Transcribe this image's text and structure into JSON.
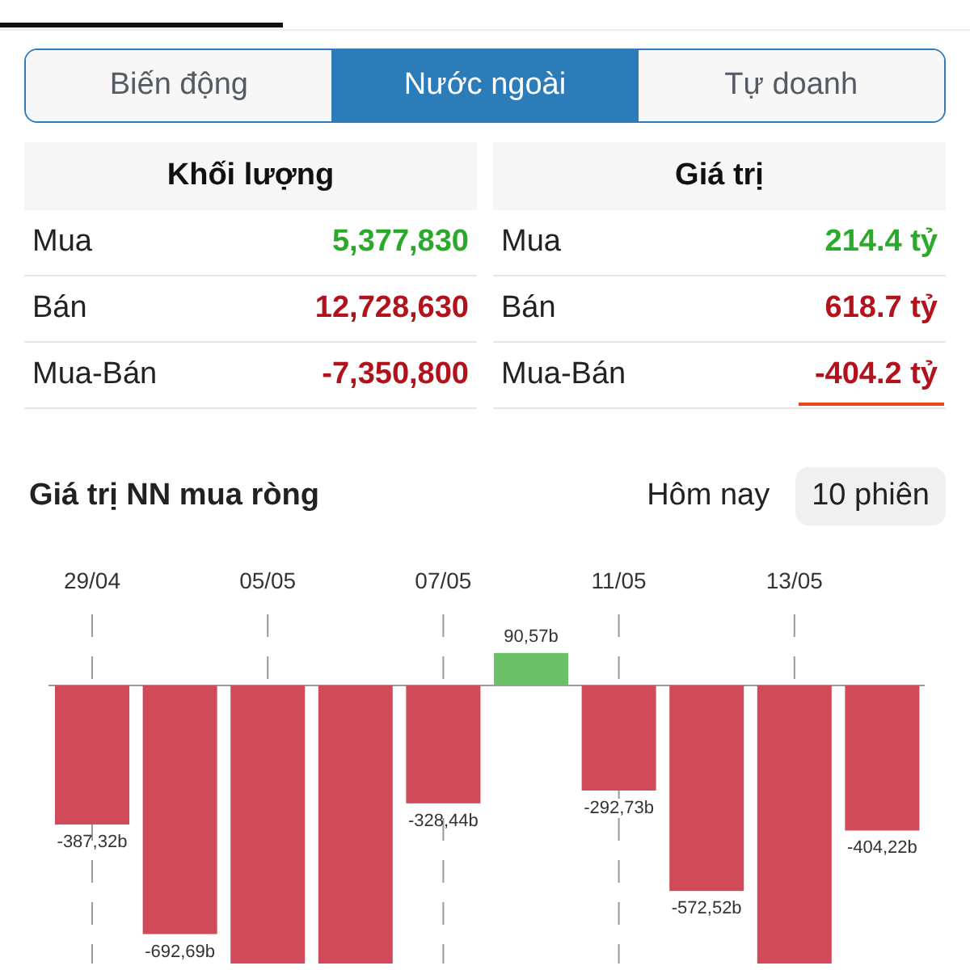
{
  "tabs": [
    {
      "label": "Biến động",
      "selected": false
    },
    {
      "label": "Nước ngoài",
      "selected": true
    },
    {
      "label": "Tự doanh",
      "selected": false
    }
  ],
  "tables": [
    {
      "title": "Khối lượng",
      "rows": [
        {
          "label": "Mua",
          "value": "5,377,830",
          "color": "#2aaa2a",
          "underlined": false
        },
        {
          "label": "Bán",
          "value": "12,728,630",
          "color": "#b3121c",
          "underlined": false
        },
        {
          "label": "Mua-Bán",
          "value": "-7,350,800",
          "color": "#b3121c",
          "underlined": false
        }
      ]
    },
    {
      "title": "Giá trị",
      "rows": [
        {
          "label": "Mua",
          "value": "214.4 tỷ",
          "color": "#2aaa2a",
          "underlined": false
        },
        {
          "label": "Bán",
          "value": "618.7 tỷ",
          "color": "#b3121c",
          "underlined": false
        },
        {
          "label": "Mua-Bán",
          "value": "-404.2 tỷ",
          "color": "#b3121c",
          "underlined": true
        }
      ]
    }
  ],
  "chart_section": {
    "title": "Giá trị NN mua ròng",
    "periods": [
      {
        "label": "Hôm nay",
        "selected": false
      },
      {
        "label": "10 phiên",
        "selected": true
      }
    ],
    "chart_data": {
      "type": "bar",
      "grid": true,
      "categories": [
        "29/04",
        null,
        "05/05",
        null,
        "07/05",
        null,
        "11/05",
        null,
        "13/05",
        null
      ],
      "values": [
        -387.32,
        -692.69,
        null,
        null,
        -328.44,
        90.57,
        -292.73,
        -572.52,
        null,
        -404.22
      ],
      "value_labels": [
        "-387,32b",
        "-692,69b",
        null,
        null,
        "-328,44b",
        "90,57b",
        "-292,73b",
        "-572,52b",
        null,
        "-404,22b"
      ]
    }
  }
}
